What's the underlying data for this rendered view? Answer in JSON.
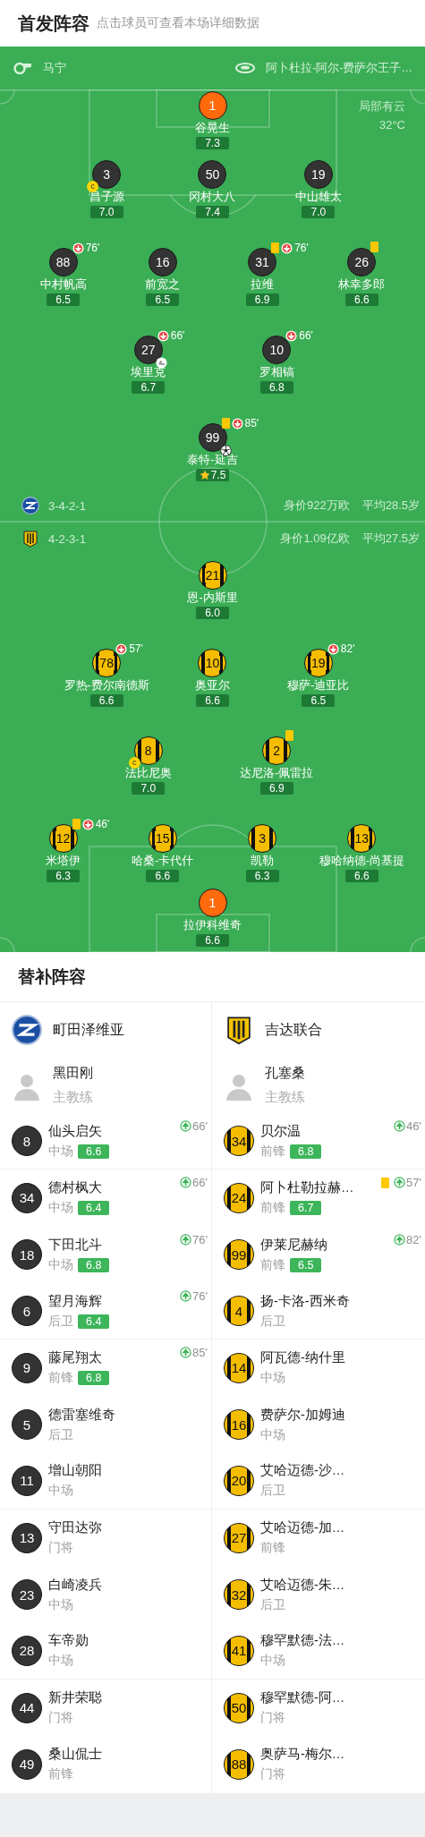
{
  "header": {
    "title": "首发阵容",
    "subtitle": "点击球员可查看本场详细数据"
  },
  "match_info": {
    "referee": "马宁",
    "stadium": "阿卜杜拉-阿尔-费萨尔王子…",
    "weather": "局部有云",
    "temperature": "32°C"
  },
  "home": {
    "kind": "dark",
    "formation": "3-4-2-1",
    "market_value": "身价922万欧",
    "average_age": "平均28.5岁",
    "lines": [
      [
        {
          "number": "1",
          "name": "谷晃生",
          "rating": "7.3",
          "kind": "goalkeeper",
          "yellow_card": false,
          "goal": false,
          "assist": false,
          "best": false
        }
      ],
      [
        {
          "number": "3",
          "name": "昌子源",
          "rating": "7.0",
          "kind": "outfield",
          "captain_badge": "c",
          "yellow_card": false,
          "goal": false,
          "assist": false,
          "best": false
        },
        {
          "number": "50",
          "name": "冈村大八",
          "rating": "7.4",
          "kind": "outfield",
          "yellow_card": false,
          "goal": false,
          "assist": false,
          "best": false
        },
        {
          "number": "19",
          "name": "中山雄太",
          "rating": "7.0",
          "kind": "outfield",
          "yellow_card": false,
          "goal": false,
          "assist": false,
          "best": false
        }
      ],
      [
        {
          "number": "88",
          "name": "中村帆高",
          "rating": "6.5",
          "kind": "outfield",
          "yellow_card": false,
          "sub_off": "76'",
          "goal": false,
          "assist": false,
          "best": false
        },
        {
          "number": "16",
          "name": "前宽之",
          "rating": "6.5",
          "kind": "outfield",
          "yellow_card": false,
          "goal": false,
          "assist": false,
          "best": false
        },
        {
          "number": "31",
          "name": "拉维",
          "rating": "6.9",
          "kind": "outfield",
          "yellow_card": true,
          "sub_off": "76'",
          "goal": false,
          "assist": false,
          "best": false
        },
        {
          "number": "26",
          "name": "林幸多郎",
          "rating": "6.6",
          "kind": "outfield",
          "yellow_card": true,
          "goal": false,
          "assist": false,
          "best": false
        }
      ],
      [
        {
          "number": "27",
          "name": "埃里克",
          "rating": "6.7",
          "kind": "outfield",
          "yellow_card": false,
          "sub_off": "66'",
          "goal": false,
          "assist": true,
          "best": false
        },
        {
          "number": "10",
          "name": "罗相镐",
          "rating": "6.8",
          "kind": "outfield",
          "yellow_card": false,
          "sub_off": "66'",
          "goal": false,
          "assist": false,
          "best": false
        }
      ],
      [
        {
          "number": "99",
          "name": "泰特-延吉",
          "rating": "7.5",
          "kind": "outfield",
          "yellow_card": true,
          "sub_off": "85'",
          "goal": true,
          "assist": false,
          "best": true
        }
      ]
    ]
  },
  "away": {
    "kind": "stripes",
    "formation": "4-2-3-1",
    "market_value": "身价1.09亿欧",
    "average_age": "平均27.5岁",
    "lines": [
      [
        {
          "number": "21",
          "name": "恩-内斯里",
          "rating": "6.0",
          "kind": "outfield",
          "yellow_card": false,
          "goal": false,
          "assist": false,
          "best": false
        }
      ],
      [
        {
          "number": "78",
          "name": "罗热-费尔南德斯",
          "rating": "6.6",
          "kind": "outfield",
          "yellow_card": false,
          "sub_off": "57'",
          "goal": false,
          "assist": false,
          "best": false
        },
        {
          "number": "10",
          "name": "奥亚尔",
          "rating": "6.6",
          "kind": "outfield",
          "yellow_card": false,
          "goal": false,
          "assist": false,
          "best": false
        },
        {
          "number": "19",
          "name": "穆萨-迪亚比",
          "rating": "6.5",
          "kind": "outfield",
          "yellow_card": false,
          "sub_off": "82'",
          "goal": false,
          "assist": false,
          "best": false
        }
      ],
      [
        {
          "number": "8",
          "name": "法比尼奥",
          "rating": "7.0",
          "kind": "outfield",
          "captain_badge": "c",
          "yellow_card": false,
          "goal": false,
          "assist": false,
          "best": false
        },
        {
          "number": "2",
          "name": "达尼洛-佩雷拉",
          "rating": "6.9",
          "kind": "outfield",
          "yellow_card": true,
          "goal": false,
          "assist": false,
          "best": false
        }
      ],
      [
        {
          "number": "12",
          "name": "米塔伊",
          "rating": "6.3",
          "kind": "outfield",
          "yellow_card": true,
          "sub_off": "46'",
          "goal": false,
          "assist": false,
          "best": false
        },
        {
          "number": "15",
          "name": "哈桑-卡代什",
          "rating": "6.6",
          "kind": "outfield",
          "yellow_card": false,
          "goal": false,
          "assist": false,
          "best": false
        },
        {
          "number": "3",
          "name": "凯勒",
          "rating": "6.3",
          "kind": "outfield",
          "yellow_card": false,
          "goal": false,
          "assist": false,
          "best": false
        },
        {
          "number": "13",
          "name": "穆哈纳德-尚基提",
          "rating": "6.6",
          "kind": "outfield",
          "yellow_card": false,
          "goal": false,
          "assist": false,
          "best": false
        }
      ],
      [
        {
          "number": "1",
          "name": "拉伊科维奇",
          "rating": "6.6",
          "kind": "goalkeeper",
          "yellow_card": false,
          "goal": false,
          "assist": false,
          "best": false
        }
      ]
    ]
  },
  "substitutes": {
    "title": "替补阵容",
    "teams": [
      {
        "name": "町田泽维亚",
        "kind": "dark",
        "coach": {
          "name": "黑田刚",
          "role": "主教练"
        },
        "players": [
          {
            "number": "8",
            "name": "仙头启矢",
            "position": "中场",
            "rating": "6.6",
            "sub_on": "66'",
            "yellow_card": false
          },
          {
            "number": "34",
            "name": "德村枫大",
            "position": "中场",
            "rating": "6.4",
            "sub_on": "66'",
            "yellow_card": false
          },
          {
            "number": "18",
            "name": "下田北斗",
            "position": "中场",
            "rating": "6.8",
            "sub_on": "76'",
            "yellow_card": false
          },
          {
            "number": "6",
            "name": "望月海辉",
            "position": "后卫",
            "rating": "6.4",
            "sub_on": "76'",
            "yellow_card": false
          },
          {
            "number": "9",
            "name": "藤尾翔太",
            "position": "前锋",
            "rating": "6.8",
            "sub_on": "85'",
            "yellow_card": false
          },
          {
            "number": "5",
            "name": "德雷塞维奇",
            "position": "后卫",
            "yellow_card": false
          },
          {
            "number": "11",
            "name": "增山朝阳",
            "position": "中场",
            "yellow_card": false
          },
          {
            "number": "13",
            "name": "守田达弥",
            "position": "门将",
            "yellow_card": false
          },
          {
            "number": "23",
            "name": "白崎凌兵",
            "position": "中场",
            "yellow_card": false
          },
          {
            "number": "28",
            "name": "车帝勋",
            "position": "中场",
            "yellow_card": false
          },
          {
            "number": "44",
            "name": "新井荣聪",
            "position": "门将",
            "yellow_card": false
          },
          {
            "number": "49",
            "name": "桑山侃士",
            "position": "前锋",
            "yellow_card": false
          }
        ]
      },
      {
        "name": "吉达联合",
        "kind": "stripes",
        "coach": {
          "name": "孔塞桑",
          "role": "主教练"
        },
        "players": [
          {
            "number": "34",
            "name": "贝尔温",
            "position": "前锋",
            "rating": "6.8",
            "sub_on": "46'",
            "yellow_card": false
          },
          {
            "number": "24",
            "name": "阿卜杜勒拉赫…",
            "position": "前锋",
            "rating": "6.7",
            "sub_on": "57'",
            "yellow_card": true
          },
          {
            "number": "99",
            "name": "伊莱尼赫纳",
            "position": "前锋",
            "rating": "6.5",
            "sub_on": "82'",
            "yellow_card": false
          },
          {
            "number": "4",
            "name": "扬-卡洛-西米奇",
            "position": "后卫",
            "yellow_card": false
          },
          {
            "number": "14",
            "name": "阿瓦德-纳什里",
            "position": "中场",
            "yellow_card": false
          },
          {
            "number": "16",
            "name": "费萨尔-加姆迪",
            "position": "中场",
            "yellow_card": false
          },
          {
            "number": "20",
            "name": "艾哈迈德-沙…",
            "position": "后卫",
            "yellow_card": false
          },
          {
            "number": "27",
            "name": "艾哈迈德-加…",
            "position": "前锋",
            "yellow_card": false
          },
          {
            "number": "32",
            "name": "艾哈迈德-朱…",
            "position": "后卫",
            "yellow_card": false
          },
          {
            "number": "41",
            "name": "穆罕默德-法…",
            "position": "中场",
            "yellow_card": false
          },
          {
            "number": "50",
            "name": "穆罕默德-阿…",
            "position": "门将",
            "yellow_card": false
          },
          {
            "number": "88",
            "name": "奥萨马-梅尔…",
            "position": "门将",
            "yellow_card": false
          }
        ]
      }
    ]
  }
}
